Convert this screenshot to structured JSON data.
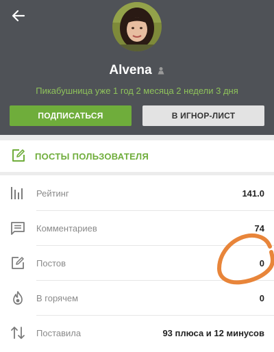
{
  "profile": {
    "username": "Alvena",
    "tenure": "Пикабушница уже 1 год 2 месяца 2 недели 3 дня"
  },
  "actions": {
    "subscribe_label": "ПОДПИСАТЬСЯ",
    "ignore_label": "В ИГНОР-ЛИСТ"
  },
  "posts_link": {
    "label": "ПОСТЫ ПОЛЬЗОВАТЕЛЯ"
  },
  "stats": [
    {
      "label": "Рейтинг",
      "value": "141.0",
      "icon": "bar-chart-icon"
    },
    {
      "label": "Комментариев",
      "value": "74",
      "icon": "comment-icon"
    },
    {
      "label": "Постов",
      "value": "0",
      "icon": "edit-icon"
    },
    {
      "label": "В горячем",
      "value": "0",
      "icon": "flame-icon"
    },
    {
      "label": "Поставила",
      "value": "93 плюса и 12 минусов",
      "icon": "up-down-arrows-icon"
    }
  ],
  "colors": {
    "header_bg": "#4f5257",
    "accent_green": "#6fad3b",
    "tenure_green": "#8fc35b",
    "annotation_orange": "#e8853a"
  }
}
